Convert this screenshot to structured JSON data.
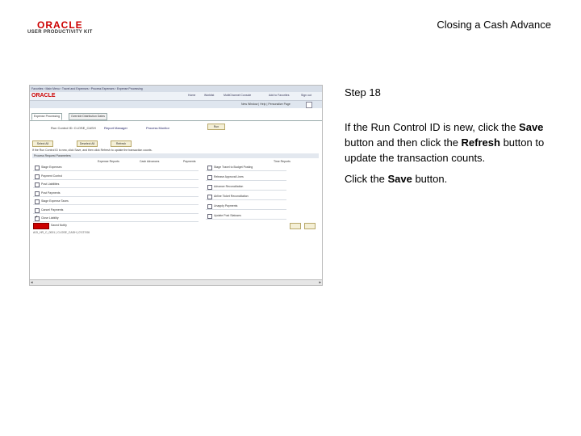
{
  "header": {
    "logo_oracle": "ORACLE",
    "logo_upk": "USER PRODUCTIVITY KIT",
    "title": "Closing a Cash Advance"
  },
  "instructions": {
    "step": "Step 18",
    "para1_a": "If the Run Control ID is new, click the ",
    "para1_save": "Save",
    "para1_b": " button and then click the ",
    "para1_refresh": "Refresh",
    "para1_c": " button to update the transaction counts.",
    "para2_a": "Click the ",
    "para2_save": "Save",
    "para2_b": " button."
  },
  "screenshot": {
    "breadcrumb": "Favorites  ›  Main Menu  ›  Travel and Expenses  ›  Process Expenses  ›  Expense Processing",
    "oracle": "ORACLE",
    "nav_items": [
      "Home",
      "Worklist",
      "MultiChannel Console",
      "Add to Favorites",
      "Sign out"
    ],
    "page_links": "New Window  |  Help  |  Personalize Page",
    "tabs": [
      "Expense Processing",
      "Override Distribution Dates"
    ],
    "run_control_label": "Run Control ID: CLOSE_CASH",
    "report_manager": "Report Manager",
    "process_monitor": "Process Monitor",
    "run_button": "Run",
    "select_all": "Select All",
    "deselect_all": "Deselect All",
    "refresh": "Refresh",
    "note": "If the Run Control ID is new, click Save, and then click Refresh to update the transaction counts.",
    "section_title": "Process Request Parameters",
    "col_headers": [
      "Expense Reports",
      "Cash Advances",
      "Payments",
      "Time Reports"
    ],
    "left_rows": [
      {
        "label": "Stage Expenses",
        "checked": false
      },
      {
        "label": "Payment Control",
        "checked": false
      },
      {
        "label": "Post Liabilities",
        "checked": false
      },
      {
        "label": "Post Payments",
        "checked": false
      },
      {
        "label": "Stage Expense Taxes",
        "checked": false
      },
      {
        "label": "Cancel Payments",
        "checked": false
      },
      {
        "label": "Close Liability",
        "checked": true
      }
    ],
    "right_rows": [
      {
        "label": "Stage Travel to Budget Posting",
        "checked": false
      },
      {
        "label": "Release Approval Lines",
        "checked": false
      },
      {
        "label": "Advance Reconciliation",
        "checked": false
      },
      {
        "label": "Airline Ticket Reconciliation",
        "checked": false
      },
      {
        "label": "Unapply Payments",
        "checked": false
      },
      {
        "label": "Update Post Statuses",
        "checked": false
      }
    ],
    "status_text": "Saved  Notify",
    "footer_text": "AOI_HR_C_0001 | CLOSE_CASH | 07/27/06"
  }
}
